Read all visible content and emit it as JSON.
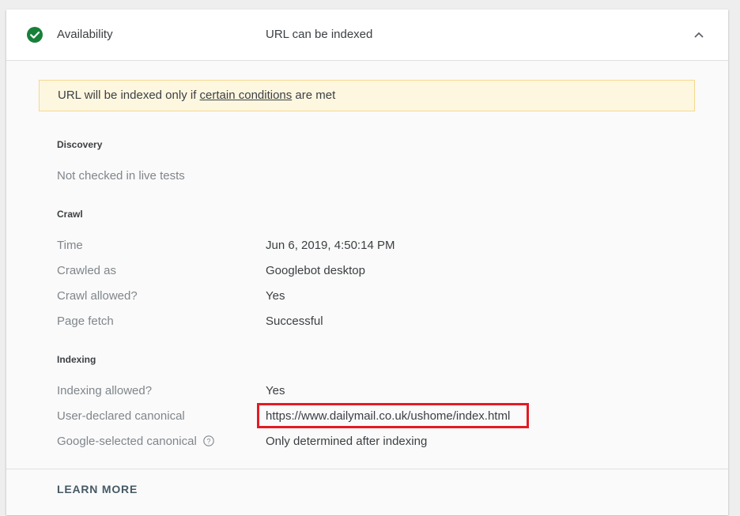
{
  "availability": {
    "label": "Availability",
    "status": "URL can be indexed"
  },
  "warning": {
    "prefix": "URL will be indexed only if ",
    "link": "certain conditions",
    "suffix": " are met"
  },
  "discovery": {
    "title": "Discovery",
    "note": "Not checked in live tests"
  },
  "crawl": {
    "title": "Crawl",
    "rows": [
      {
        "label": "Time",
        "value": "Jun 6, 2019, 4:50:14 PM"
      },
      {
        "label": "Crawled as",
        "value": "Googlebot desktop"
      },
      {
        "label": "Crawl allowed?",
        "value": "Yes"
      },
      {
        "label": "Page fetch",
        "value": "Successful"
      }
    ]
  },
  "indexing": {
    "title": "Indexing",
    "rows": [
      {
        "label": "Indexing allowed?",
        "value": "Yes"
      },
      {
        "label": "User-declared canonical",
        "value": "https://www.dailymail.co.uk/ushome/index.html"
      },
      {
        "label": "Google-selected canonical",
        "value": "Only determined after indexing"
      }
    ]
  },
  "footer": {
    "learn_more": "LEARN MORE"
  },
  "colors": {
    "success_green": "#188038",
    "warning_bg": "#fef7e0",
    "highlight_red": "#e31b23"
  },
  "icons": [
    "check-circle-icon",
    "chevron-up-icon",
    "help-icon"
  ]
}
